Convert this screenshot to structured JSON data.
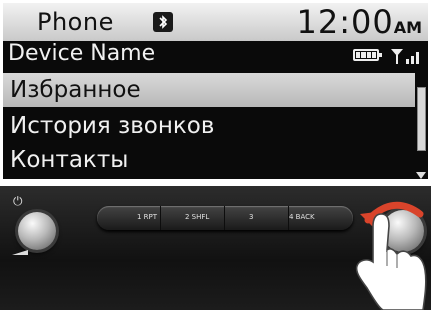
{
  "screen": {
    "app_title": "Phone",
    "bluetooth_icon": "bluetooth-icon",
    "time": "12:00",
    "ampm": "AM",
    "device_name": "Device Name",
    "battery_icon": "battery-icon",
    "signal_icon": "signal-strength-icon",
    "menu": [
      {
        "label": "Избранное",
        "selected": true
      },
      {
        "label": "История звонков",
        "selected": false
      },
      {
        "label": "Контакты",
        "selected": false
      }
    ]
  },
  "controls": {
    "presets": [
      {
        "label": "1 RPT"
      },
      {
        "label": "2 SHFL"
      },
      {
        "label": "3"
      },
      {
        "label": "4 BACK"
      }
    ],
    "power_icon": "power-icon",
    "colors": {
      "screen_bg": "#0a0a0a",
      "highlight": "#c8c8c8",
      "arrow": "#d9442b"
    }
  }
}
